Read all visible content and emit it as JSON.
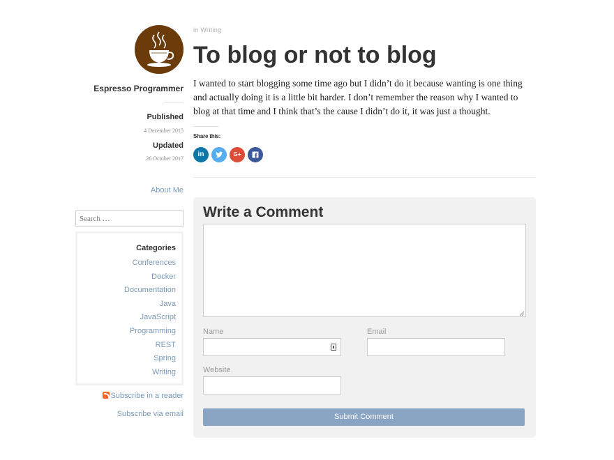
{
  "sidebar": {
    "author": "Espresso Programmer",
    "published_label": "Published",
    "published_date": "4 December 2015",
    "updated_label": "Updated",
    "updated_date": "26 October 2017",
    "about_link": "About Me",
    "search_placeholder": "Search …",
    "categories_title": "Categories",
    "categories": [
      "Conferences",
      "Docker",
      "Documentation",
      "Java",
      "JavaScript",
      "Programming",
      "REST",
      "Spring",
      "Writing"
    ],
    "rss_link": "Subscribe in a reader",
    "email_link": "Subscribe via email"
  },
  "post": {
    "breadcrumb_prefix": "in",
    "breadcrumb_category": "Writing",
    "title": "To blog or not to blog",
    "body": "I wanted to start blogging some time ago but I didn’t do it because wanting is one thing and actually doing it is a little bit harder. I don’t remember the reason why I wanted to blog at that time and I think that’s the cause I didn’t do it, it was just a thought.",
    "share_label": "Share this:",
    "share_buttons": [
      {
        "name": "linkedin",
        "glyph": "in",
        "color": "#0e76a8"
      },
      {
        "name": "twitter",
        "glyph": "t",
        "color": "#55acee"
      },
      {
        "name": "google-plus",
        "glyph": "G+",
        "color": "#dd4b39"
      },
      {
        "name": "facebook",
        "glyph": "f",
        "color": "#3b5998"
      }
    ]
  },
  "comment_form": {
    "title": "Write a Comment",
    "name_label": "Name",
    "email_label": "Email",
    "website_label": "Website",
    "submit_label": "Submit Comment"
  }
}
